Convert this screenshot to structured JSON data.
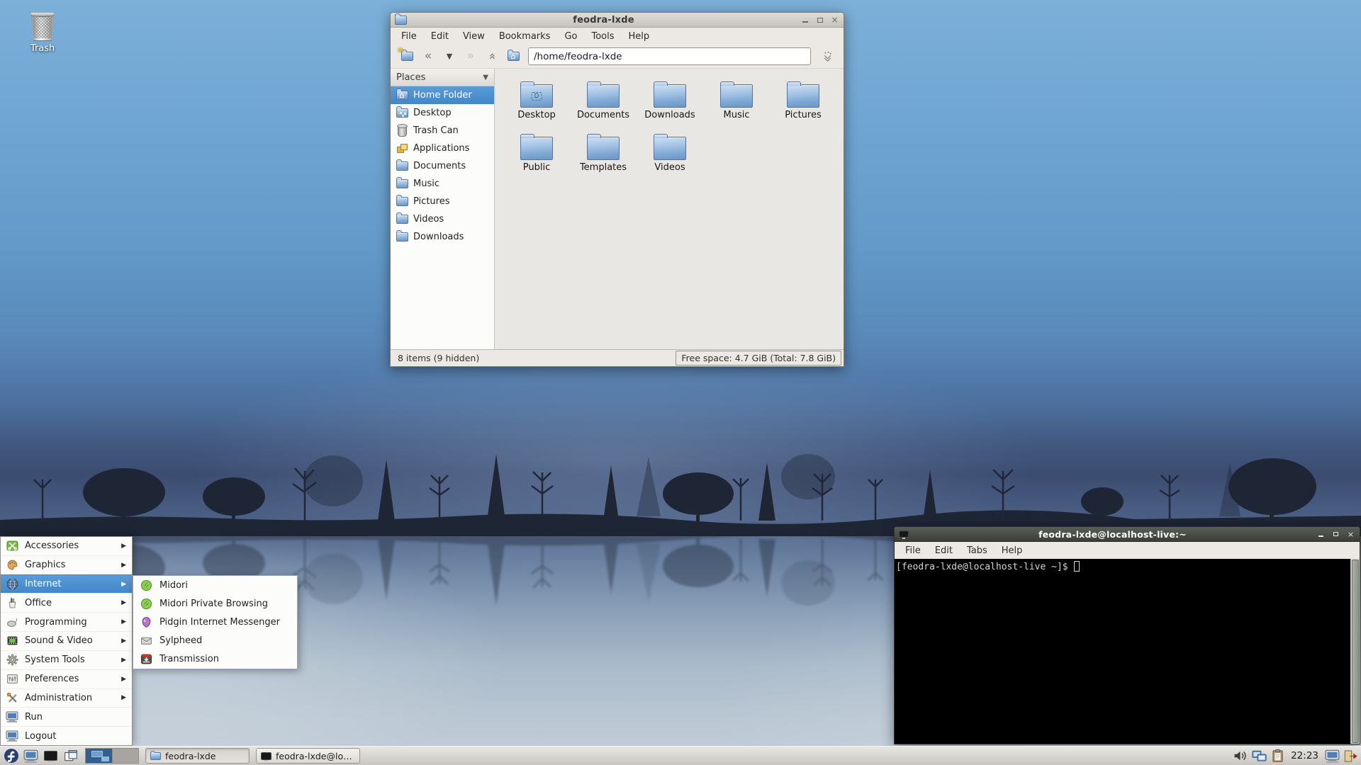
{
  "colors": {
    "selection_blue": "#4a90d2",
    "desktop_sky": "#6fa3d0",
    "terminal_bg": "#000000",
    "terminal_fg": "#d3d7cf",
    "chrome": "#ece9e5"
  },
  "desktop": {
    "trash_label": "Trash"
  },
  "file_manager": {
    "title": "feodra-lxde",
    "menu": [
      "File",
      "Edit",
      "View",
      "Bookmarks",
      "Go",
      "Tools",
      "Help"
    ],
    "path": "/home/feodra-lxde",
    "places": {
      "header": "Places",
      "items": [
        {
          "label": "Home Folder",
          "icon": "home-folder",
          "selected": true
        },
        {
          "label": "Desktop",
          "icon": "desktop-folder",
          "selected": false
        },
        {
          "label": "Trash Can",
          "icon": "trash",
          "selected": false
        },
        {
          "label": "Applications",
          "icon": "applications",
          "selected": false
        },
        {
          "label": "Documents",
          "icon": "folder",
          "selected": false
        },
        {
          "label": "Music",
          "icon": "folder",
          "selected": false
        },
        {
          "label": "Pictures",
          "icon": "folder",
          "selected": false
        },
        {
          "label": "Videos",
          "icon": "folder",
          "selected": false
        },
        {
          "label": "Downloads",
          "icon": "folder",
          "selected": false
        }
      ]
    },
    "files": [
      {
        "label": "Desktop",
        "icon": "desktop-folder"
      },
      {
        "label": "Documents",
        "icon": "folder"
      },
      {
        "label": "Downloads",
        "icon": "folder"
      },
      {
        "label": "Music",
        "icon": "folder"
      },
      {
        "label": "Pictures",
        "icon": "folder"
      },
      {
        "label": "Public",
        "icon": "folder"
      },
      {
        "label": "Templates",
        "icon": "folder"
      },
      {
        "label": "Videos",
        "icon": "folder"
      }
    ],
    "status": {
      "left": "8 items (9 hidden)",
      "right": "Free space: 4.7 GiB (Total: 7.8 GiB)"
    }
  },
  "terminal": {
    "title": "feodra-lxde@localhost-live:~",
    "menu": [
      "File",
      "Edit",
      "Tabs",
      "Help"
    ],
    "prompt": "[feodra-lxde@localhost-live ~]$"
  },
  "start_menu": {
    "items": [
      {
        "label": "Accessories",
        "icon": "accessories",
        "submenu": true,
        "highlighted": false
      },
      {
        "label": "Graphics",
        "icon": "graphics",
        "submenu": true,
        "highlighted": false
      },
      {
        "label": "Internet",
        "icon": "internet",
        "submenu": true,
        "highlighted": true
      },
      {
        "label": "Office",
        "icon": "office",
        "submenu": true,
        "highlighted": false
      },
      {
        "label": "Programming",
        "icon": "programming",
        "submenu": true,
        "highlighted": false
      },
      {
        "label": "Sound & Video",
        "icon": "sound-video",
        "submenu": true,
        "highlighted": false
      },
      {
        "label": "System Tools",
        "icon": "system-tools",
        "submenu": true,
        "highlighted": false
      },
      {
        "label": "Preferences",
        "icon": "preferences",
        "submenu": true,
        "highlighted": false
      },
      {
        "label": "Administration",
        "icon": "administration",
        "submenu": true,
        "highlighted": false
      },
      {
        "label": "Run",
        "icon": "run",
        "submenu": false,
        "highlighted": false
      },
      {
        "label": "Logout",
        "icon": "logout",
        "submenu": false,
        "highlighted": false
      }
    ],
    "submenu": {
      "items": [
        {
          "label": "Midori",
          "icon": "midori"
        },
        {
          "label": "Midori Private Browsing",
          "icon": "midori"
        },
        {
          "label": "Pidgin Internet Messenger",
          "icon": "pidgin"
        },
        {
          "label": "Sylpheed",
          "icon": "sylpheed"
        },
        {
          "label": "Transmission",
          "icon": "transmission"
        }
      ]
    }
  },
  "taskbar": {
    "launchers": [
      "file-manager",
      "terminal",
      "iconify-windows"
    ],
    "workspaces": 2,
    "active_workspace": 1,
    "tasks": [
      {
        "label": "feodra-lxde",
        "icon": "folder"
      },
      {
        "label": "feodra-lxde@loc...",
        "icon": "terminal"
      }
    ],
    "tray": [
      "volume",
      "network",
      "clipboard",
      "display",
      "logout"
    ],
    "clock": "22:23"
  }
}
